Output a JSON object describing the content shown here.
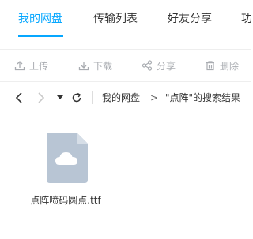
{
  "tabs": [
    {
      "label": "我的网盘",
      "active": true
    },
    {
      "label": "传输列表",
      "active": false
    },
    {
      "label": "好友分享",
      "active": false
    },
    {
      "label": "功",
      "active": false
    }
  ],
  "toolbar": {
    "upload": {
      "label": "上传",
      "icon": "upload-icon"
    },
    "download": {
      "label": "下载",
      "icon": "download-icon"
    },
    "share": {
      "label": "分享",
      "icon": "share-icon"
    },
    "delete": {
      "label": "删除",
      "icon": "trash-icon"
    }
  },
  "breadcrumb": {
    "root": "我的网盘",
    "separator": ">",
    "current": "\"点阵\"的搜索结果"
  },
  "files": [
    {
      "name": "点阵喷码圆点.ttf",
      "icon": "cloud-file-icon"
    }
  ],
  "colors": {
    "accent": "#06a7ff",
    "toolbar_disabled": "#a9acb1",
    "file_icon_bg": "#b8c5d4"
  }
}
